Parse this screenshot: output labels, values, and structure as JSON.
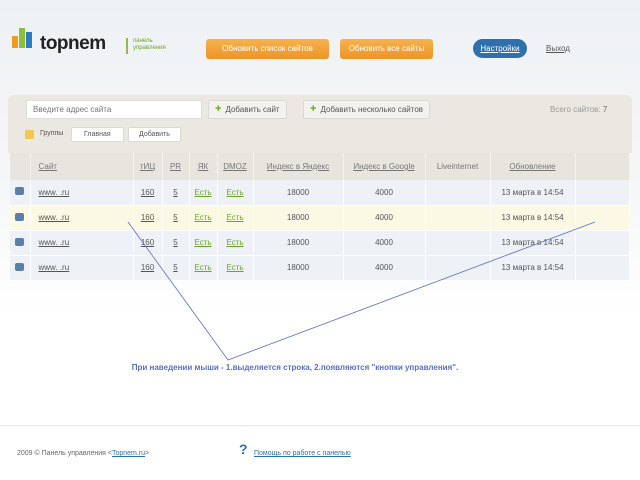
{
  "header": {
    "brand": "topnem",
    "subtitle_1": "панель",
    "subtitle_2": "управления",
    "refresh_list": "Обновить список сайтов",
    "refresh_all": "Обновить все сайты",
    "settings": "Настройки",
    "logout": "Выход"
  },
  "toolbar": {
    "placeholder": "Введите адрес сайта",
    "add_site": "Добавить сайт",
    "add_many": "Добавить несколько сайтов",
    "total_label": "Всего сайтов:",
    "total": "7",
    "groups_label": "Группы",
    "group_main": "Главная",
    "group_add": "Добавить"
  },
  "table": {
    "headers": [
      "Сайт",
      "тИЦ",
      "PR",
      "ЯК",
      "DMOZ",
      "Индекс в Яндекс",
      "Индекс в Google",
      "Liveinternet",
      "Обновление"
    ],
    "rows": [
      {
        "site": "www.              .ru",
        "tic": "160",
        "pr": "5",
        "yk": "Есть",
        "dmoz": "Есть",
        "yandex": "18000",
        "google": "4000",
        "li": "",
        "updated": "13 марта в 14:54"
      },
      {
        "site": "www.              .ru",
        "tic": "160",
        "pr": "5",
        "yk": "Есть",
        "dmoz": "Есть",
        "yandex": "18000",
        "google": "4000",
        "li": "",
        "updated": "13 марта в 14:54"
      },
      {
        "site": "www.              .ru",
        "tic": "160",
        "pr": "5",
        "yk": "Есть",
        "dmoz": "Есть",
        "yandex": "18000",
        "google": "4000",
        "li": "",
        "updated": "13 марта в 14:54"
      },
      {
        "site": "www.              .ru",
        "tic": "160",
        "pr": "5",
        "yk": "Есть",
        "dmoz": "Есть",
        "yandex": "18000",
        "google": "4000",
        "li": "",
        "updated": "13 марта в 14:54"
      }
    ]
  },
  "annotation": "При наведении мыши - 1.выделяется строка, 2.появляются \"кнопки управления\".",
  "footer": {
    "copyright": "2009 © Панель управления <",
    "link": "Topnem.ru",
    "close": ">",
    "help_icon": "?",
    "help": "Помощь по работе с панелью"
  }
}
